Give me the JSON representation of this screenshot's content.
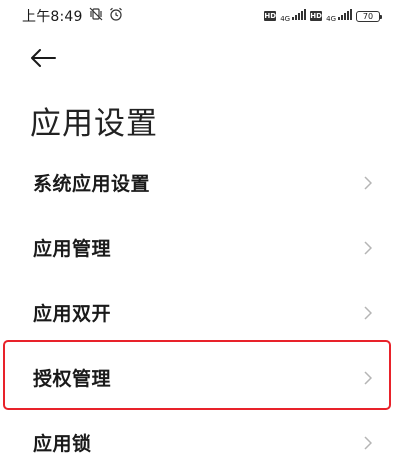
{
  "status_bar": {
    "time": "上午8:49",
    "network_label_1": "4G",
    "network_label_2": "4G",
    "hd_label": "HD",
    "battery_level": "70"
  },
  "header": {
    "back_icon": "arrow-left-icon",
    "title": "应用设置"
  },
  "settings": {
    "items": [
      {
        "label": "系统应用设置",
        "icon": "chevron-right-icon"
      },
      {
        "label": "应用管理",
        "icon": "chevron-right-icon"
      },
      {
        "label": "应用双开",
        "icon": "chevron-right-icon"
      },
      {
        "label": "授权管理",
        "icon": "chevron-right-icon",
        "highlighted": true
      },
      {
        "label": "应用锁",
        "icon": "chevron-right-icon"
      }
    ]
  },
  "colors": {
    "highlight_border": "#e8222a",
    "text": "#1a1a1a",
    "chevron": "#b5b5b5"
  }
}
